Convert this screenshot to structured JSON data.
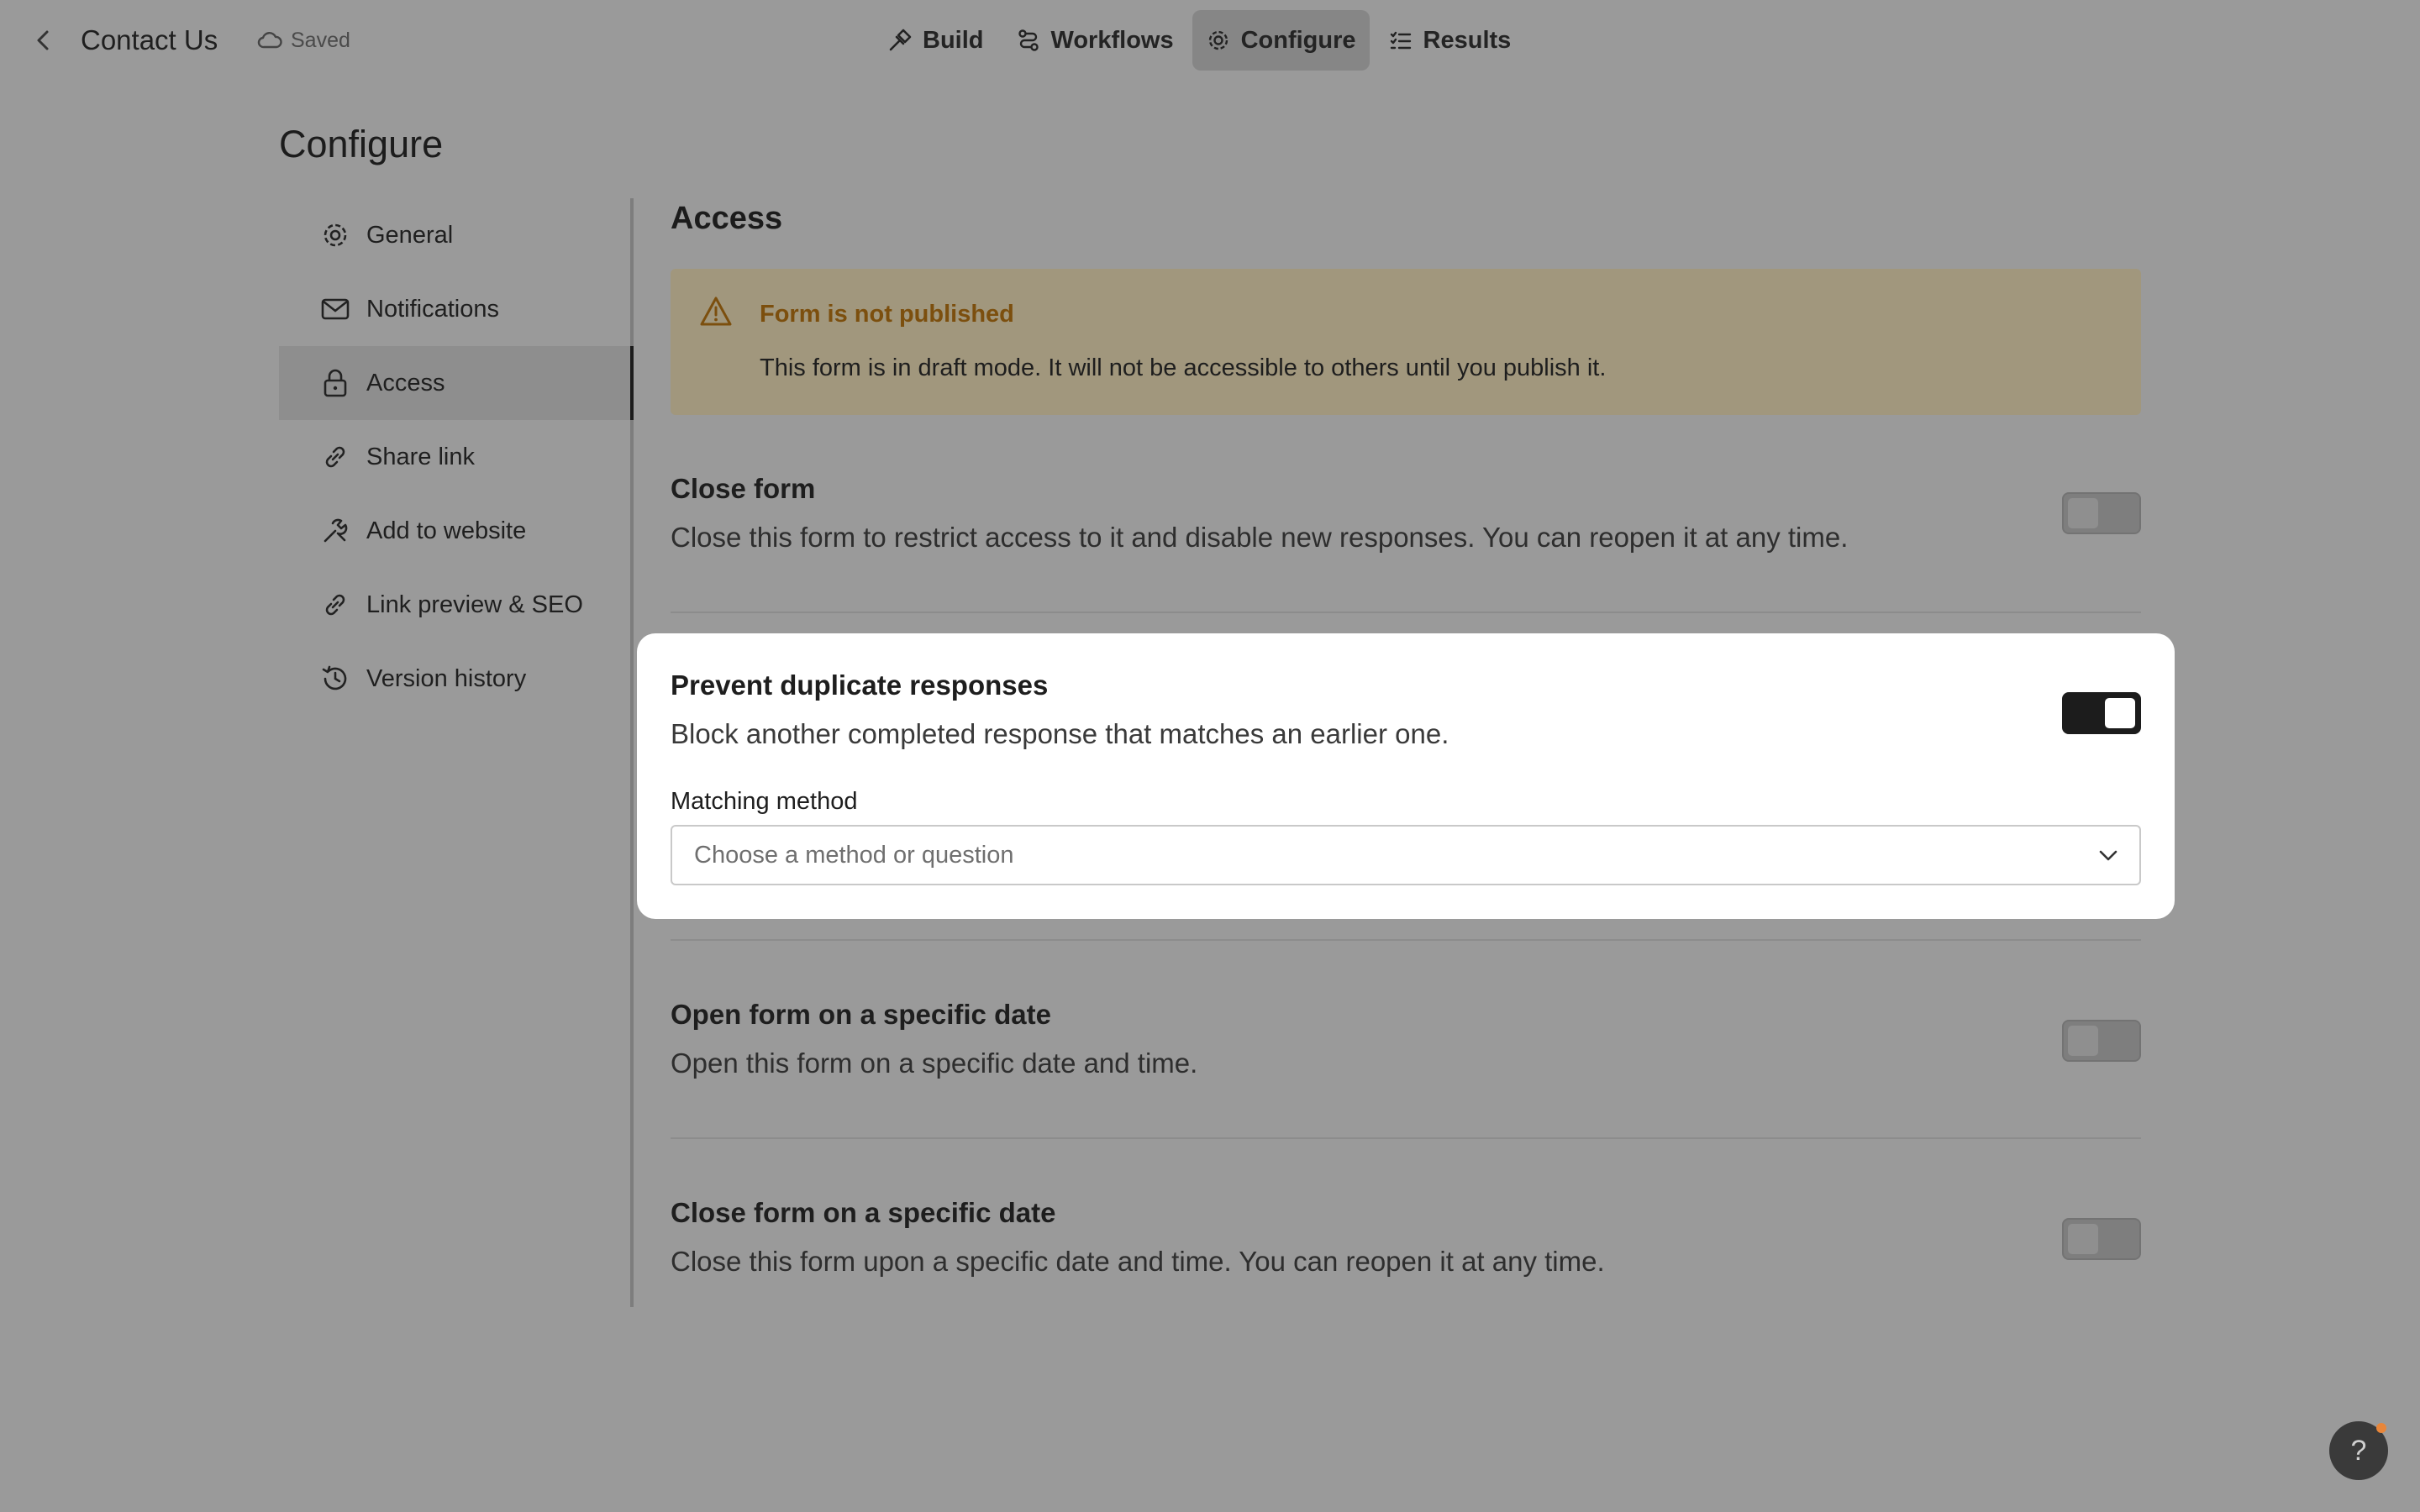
{
  "header": {
    "title": "Contact Us",
    "save_status": "Saved",
    "tabs": [
      {
        "label": "Build",
        "icon": "hammer-icon",
        "active": false
      },
      {
        "label": "Workflows",
        "icon": "workflow-icon",
        "active": false
      },
      {
        "label": "Configure",
        "icon": "gear-icon",
        "active": true
      },
      {
        "label": "Results",
        "icon": "list-icon",
        "active": false
      }
    ]
  },
  "page": {
    "heading": "Configure"
  },
  "sidebar": {
    "items": [
      {
        "label": "General",
        "icon": "gear-icon"
      },
      {
        "label": "Notifications",
        "icon": "mail-icon"
      },
      {
        "label": "Access",
        "icon": "lock-icon",
        "active": true
      },
      {
        "label": "Share link",
        "icon": "link-icon"
      },
      {
        "label": "Add to website",
        "icon": "wrench-icon"
      },
      {
        "label": "Link preview & SEO",
        "icon": "link-icon"
      },
      {
        "label": "Version history",
        "icon": "history-icon"
      }
    ]
  },
  "main": {
    "section_title": "Access",
    "alert": {
      "title": "Form is not published",
      "text": "This form is in draft mode. It will not be accessible to others until you publish it."
    },
    "settings": [
      {
        "title": "Close form",
        "description": "Close this form to restrict access to it and disable new responses. You can reopen it at any time.",
        "enabled": false
      },
      {
        "title": "Prevent duplicate responses",
        "description": "Block another completed response that matches an earlier one.",
        "enabled": true
      },
      {
        "title": "Open form on a specific date",
        "description": "Open this form on a specific date and time.",
        "enabled": false
      },
      {
        "title": "Close form on a specific date",
        "description": "Close this form upon a specific date and time. You can reopen it at any time.",
        "enabled": false
      }
    ],
    "matching": {
      "label": "Matching method",
      "placeholder": "Choose a method or question"
    }
  },
  "help": {
    "label": "?"
  }
}
